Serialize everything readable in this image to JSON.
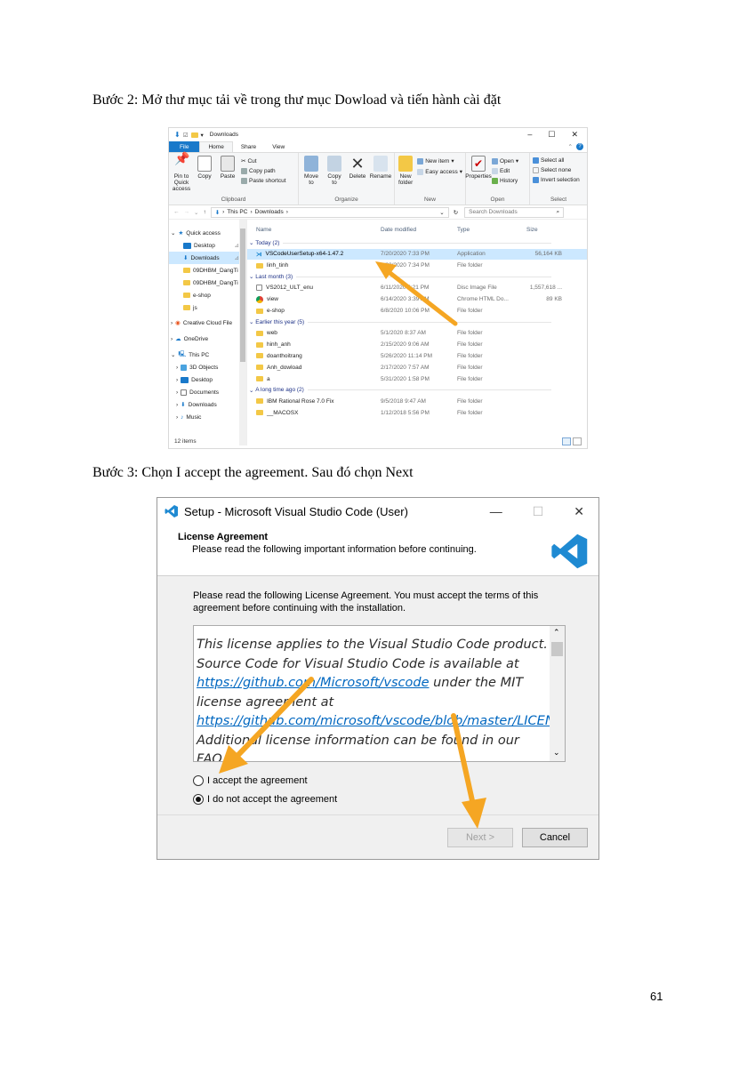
{
  "captions": {
    "step2": "Bước 2: Mở thư mục tải về trong thư mục Dowload và  tiến hành cài đặt",
    "step3": "Bước 3: Chọn I accept the agreement. Sau đó chọn Next"
  },
  "page_number": "61",
  "explorer": {
    "title": "Downloads",
    "tabs": [
      "File",
      "Home",
      "Share",
      "View"
    ],
    "ribbon": {
      "clipboard": {
        "label": "Clipboard",
        "pin": "Pin to Quick access",
        "copy": "Copy",
        "paste": "Paste",
        "cut": "Cut",
        "copy_path": "Copy path",
        "paste_shortcut": "Paste shortcut"
      },
      "organize": {
        "label": "Organize",
        "move_to": "Move to",
        "copy_to": "Copy to",
        "delete": "Delete",
        "rename": "Rename"
      },
      "new": {
        "label": "New",
        "new_folder": "New folder",
        "new_item": "New item",
        "easy_access": "Easy access"
      },
      "open": {
        "label": "Open",
        "properties": "Properties",
        "open": "Open",
        "edit": "Edit",
        "history": "History"
      },
      "select": {
        "label": "Select",
        "select_all": "Select all",
        "select_none": "Select none",
        "invert": "Invert selection"
      }
    },
    "address": {
      "this_pc": "This PC",
      "downloads": "Downloads",
      "search_placeholder": "Search Downloads"
    },
    "nav": [
      {
        "label": "Quick access"
      },
      {
        "label": "Desktop"
      },
      {
        "label": "Downloads"
      },
      {
        "label": "09DHBM_DangTi"
      },
      {
        "label": "09DHBM_DangTi"
      },
      {
        "label": "e-shop"
      },
      {
        "label": "js"
      },
      {
        "label": "Creative Cloud File"
      },
      {
        "label": "OneDrive"
      },
      {
        "label": "This PC"
      },
      {
        "label": "3D Objects"
      },
      {
        "label": "Desktop"
      },
      {
        "label": "Documents"
      },
      {
        "label": "Downloads"
      },
      {
        "label": "Music"
      }
    ],
    "columns": [
      "Name",
      "Date modified",
      "Type",
      "Size"
    ],
    "groups": [
      {
        "header": "Today (2)",
        "rows": [
          {
            "name": "VSCodeUserSetup-x64-1.47.2",
            "date": "7/20/2020 7:33 PM",
            "type": "Application",
            "size": "56,164 KB"
          },
          {
            "name": "linh_tinh",
            "date": "7/20/2020 7:34 PM",
            "type": "File folder",
            "size": ""
          }
        ]
      },
      {
        "header": "Last month (3)",
        "rows": [
          {
            "name": "VS2012_ULT_enu",
            "date": "6/11/2020 4:21 PM",
            "type": "Disc Image File",
            "size": "1,557,618 ..."
          },
          {
            "name": "view",
            "date": "6/14/2020 3:39 AM",
            "type": "Chrome HTML Do...",
            "size": "89 KB"
          },
          {
            "name": "e-shop",
            "date": "6/8/2020 10:06 PM",
            "type": "File folder",
            "size": ""
          }
        ]
      },
      {
        "header": "Earlier this year (5)",
        "rows": [
          {
            "name": "web",
            "date": "5/1/2020 8:37 AM",
            "type": "File folder",
            "size": ""
          },
          {
            "name": "hinh_anh",
            "date": "2/15/2020 9:06 AM",
            "type": "File folder",
            "size": ""
          },
          {
            "name": "doanthoitrang",
            "date": "5/26/2020 11:14 PM",
            "type": "File folder",
            "size": ""
          },
          {
            "name": "Anh_dowload",
            "date": "2/17/2020 7:57 AM",
            "type": "File folder",
            "size": ""
          },
          {
            "name": "a",
            "date": "5/31/2020 1:58 PM",
            "type": "File folder",
            "size": ""
          }
        ]
      },
      {
        "header": "A long time ago (2)",
        "rows": [
          {
            "name": "IBM Rational Rose 7.0 Fix",
            "date": "9/5/2018 9:47 AM",
            "type": "File folder",
            "size": ""
          },
          {
            "name": "__MACOSX",
            "date": "1/12/2018 5:56 PM",
            "type": "File folder",
            "size": ""
          }
        ]
      }
    ],
    "status": "12 items"
  },
  "setup": {
    "title": "Setup - Microsoft Visual Studio Code (User)",
    "header_title": "License Agreement",
    "header_sub": "Please read the following important information before continuing.",
    "intro": "Please read the following License Agreement. You must accept the terms of this agreement before continuing with the installation.",
    "license": {
      "p1": "This license applies to the Visual Studio Code product. Source Code for Visual Studio Code is available at ",
      "link1": "https://github.com/Microsoft/vscode",
      "p2": " under the MIT license agreement at ",
      "link2": "https://github.com/microsoft/vscode/blob/master/LICENSE.txt",
      "p3": ". Additional license information can be found in our FAQ at"
    },
    "accept": "I accept the agreement",
    "decline": "I do not accept the agreement",
    "next": "Next >",
    "cancel": "Cancel",
    "colors": {
      "accent": "#f5a623",
      "vscode_blue": "#1f8ad2"
    }
  }
}
